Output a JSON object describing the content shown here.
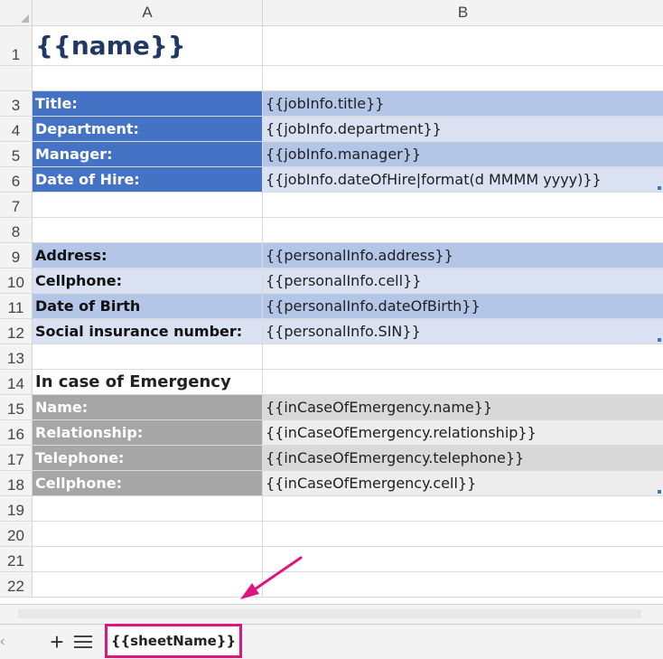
{
  "columns": [
    "A",
    "B"
  ],
  "rows": [
    {
      "num": "1",
      "a": "{{name}}",
      "b": ""
    },
    {
      "num": "",
      "a": "",
      "b": ""
    },
    {
      "num": "3",
      "a": "Title:",
      "b": "{{jobInfo.title}}"
    },
    {
      "num": "4",
      "a": "Department:",
      "b": "{{jobInfo.department}}"
    },
    {
      "num": "5",
      "a": "Manager:",
      "b": "{{jobInfo.manager}}"
    },
    {
      "num": "6",
      "a": "Date of Hire:",
      "b": "{{jobInfo.dateOfHire|format(d MMMM yyyy)}}"
    },
    {
      "num": "7",
      "a": "",
      "b": ""
    },
    {
      "num": "8",
      "a": "",
      "b": ""
    },
    {
      "num": "9",
      "a": "Address:",
      "b": "{{personalInfo.address}}"
    },
    {
      "num": "10",
      "a": "Cellphone:",
      "b": "{{personalInfo.cell}}"
    },
    {
      "num": "11",
      "a": "Date of Birth",
      "b": "{{personalInfo.dateOfBirth}}"
    },
    {
      "num": "12",
      "a": "Social insurance number:",
      "b": "{{personalInfo.SIN}}"
    },
    {
      "num": "13",
      "a": "",
      "b": ""
    },
    {
      "num": "14",
      "a": "In case of Emergency",
      "b": ""
    },
    {
      "num": "15",
      "a": "Name:",
      "b": "{{inCaseOfEmergency.name}}"
    },
    {
      "num": "16",
      "a": "Relationship:",
      "b": "{{inCaseOfEmergency.relationship}}"
    },
    {
      "num": "17",
      "a": "Telephone:",
      "b": "{{inCaseOfEmergency.telephone}}"
    },
    {
      "num": "18",
      "a": "Cellphone:",
      "b": "{{inCaseOfEmergency.cell}}"
    },
    {
      "num": "19",
      "a": "",
      "b": ""
    },
    {
      "num": "20",
      "a": "",
      "b": ""
    },
    {
      "num": "21",
      "a": "",
      "b": ""
    },
    {
      "num": "22",
      "a": "",
      "b": ""
    }
  ],
  "tabbar": {
    "add_icon": "+",
    "sheet_tab_label": "{{sheetName}}"
  },
  "colors": {
    "dark_blue": "#4472c4",
    "light_blue": "#b4c6e7",
    "pale_blue": "#d9e1f2",
    "gray": "#a6a6a6",
    "annotation_pink": "#e0147f"
  }
}
